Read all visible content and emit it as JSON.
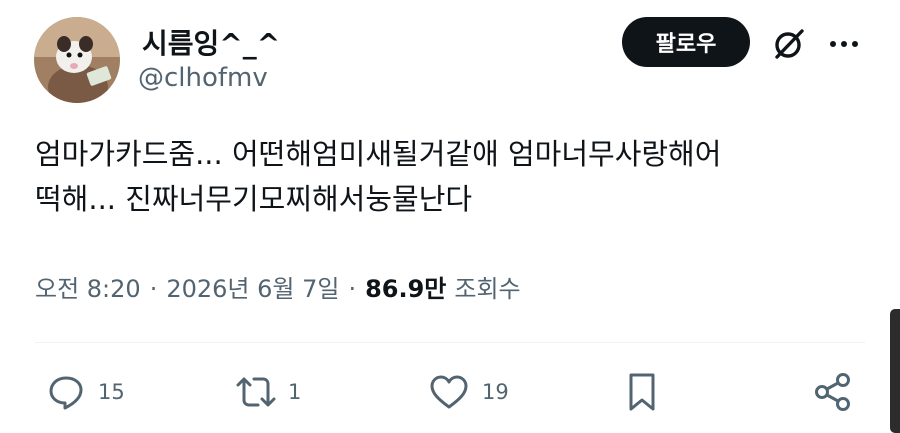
{
  "author": {
    "display_name": "시름잉^_^",
    "handle": "@clhofmv",
    "follow_label": "팔로우"
  },
  "tweet": {
    "lines": [
      "엄마가카드줌... 어떤해엄미새될거같애 엄마너무사랑해어",
      "떡해... 진짜너무기모찌해서눙물난다"
    ],
    "time": "오전 8:20",
    "separator": "·",
    "date": "2026년 6월 7일",
    "views_count": "86.9만",
    "views_label": "조회수"
  },
  "actions": {
    "replies": "15",
    "retweets": "1",
    "likes": "19"
  },
  "icons": [
    "grok-icon",
    "more-icon",
    "reply-icon",
    "retweet-icon",
    "like-icon",
    "bookmark-icon",
    "share-icon"
  ],
  "colors": {
    "text": "#0f1419",
    "secondary": "#536471",
    "button": "#0f1419"
  }
}
